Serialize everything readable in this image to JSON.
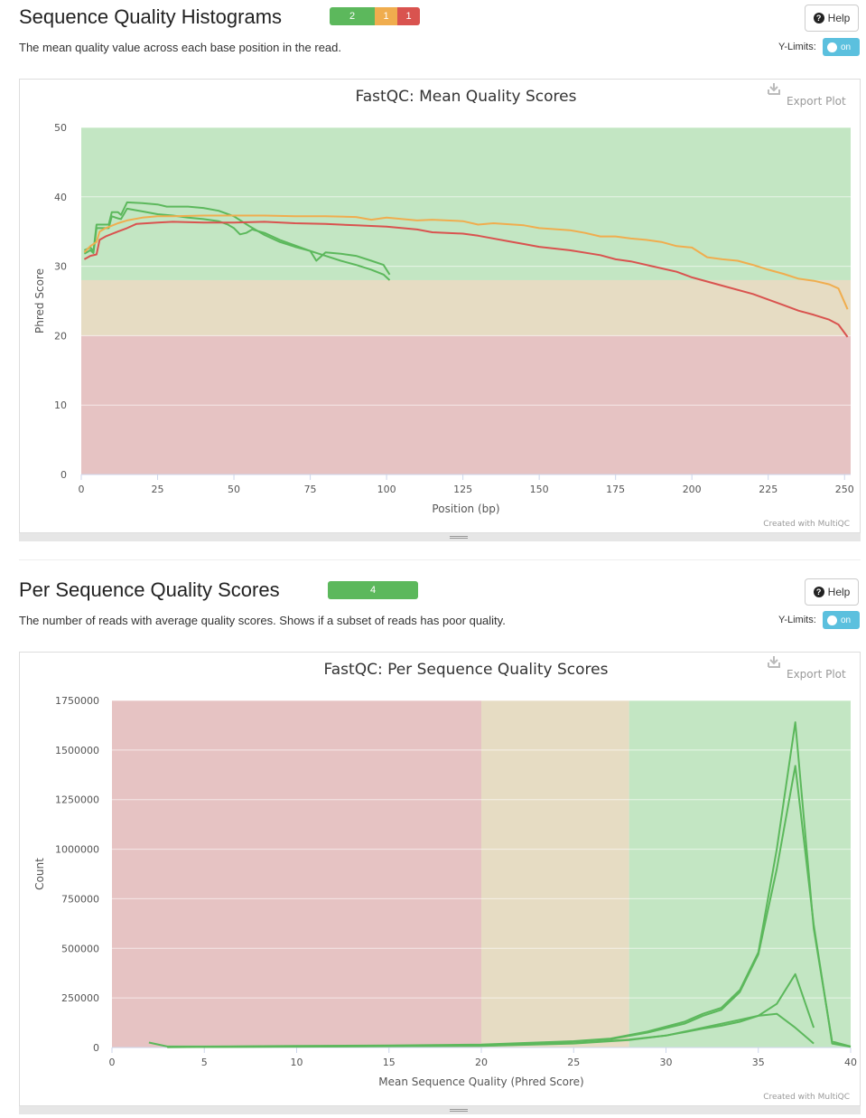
{
  "sections": [
    {
      "title": "Sequence Quality Histograms",
      "status": [
        {
          "label": "2",
          "color": "#5cb85c",
          "width": 50
        },
        {
          "label": "1",
          "color": "#f0ad4e",
          "width": 25
        },
        {
          "label": "1",
          "color": "#d9534f",
          "width": 25
        }
      ],
      "description": "The mean quality value across each base position in the read.",
      "help_label": "Help",
      "ylimits_label": "Y-Limits:",
      "toggle_label": "on"
    },
    {
      "title": "Per Sequence Quality Scores",
      "status": [
        {
          "label": "4",
          "color": "#5cb85c",
          "width": 100
        }
      ],
      "description": "The number of reads with average quality scores. Shows if a subset of reads has poor quality.",
      "help_label": "Help",
      "ylimits_label": "Y-Limits:",
      "toggle_label": "on"
    }
  ],
  "export_label": "Export Plot",
  "credit": "Created with MultiQC",
  "chart_data": [
    {
      "type": "line",
      "title": "FastQC: Mean Quality Scores",
      "xlabel": "Position (bp)",
      "ylabel": "Phred Score",
      "xlim": [
        0,
        252
      ],
      "ylim": [
        0,
        50
      ],
      "x_ticks": [
        0,
        25,
        50,
        75,
        100,
        125,
        150,
        175,
        200,
        225,
        250
      ],
      "y_ticks": [
        0,
        10,
        20,
        30,
        40,
        50
      ],
      "bands": [
        {
          "from": 28,
          "to": 50,
          "color": "#c3e6c3"
        },
        {
          "from": 20,
          "to": 28,
          "color": "#e6dcc3"
        },
        {
          "from": 0,
          "to": 20,
          "color": "#e6c3c3"
        }
      ],
      "series": [
        {
          "color": "#5cb85c",
          "points": [
            [
              1,
              32.3
            ],
            [
              3,
              32.7
            ],
            [
              4,
              32.2
            ],
            [
              5,
              36
            ],
            [
              7,
              36
            ],
            [
              9,
              36
            ],
            [
              10,
              37.8
            ],
            [
              12,
              37.8
            ],
            [
              13,
              37.4
            ],
            [
              15,
              39.2
            ],
            [
              20,
              39.1
            ],
            [
              25,
              38.9
            ],
            [
              28,
              38.6
            ],
            [
              30,
              38.6
            ],
            [
              35,
              38.6
            ],
            [
              40,
              38.4
            ],
            [
              45,
              38
            ],
            [
              50,
              37.2
            ],
            [
              55,
              35.8
            ],
            [
              60,
              34.5
            ],
            [
              65,
              33.5
            ],
            [
              70,
              32.8
            ],
            [
              75,
              32.2
            ],
            [
              77,
              30.8
            ],
            [
              80,
              32
            ],
            [
              85,
              31.8
            ],
            [
              90,
              31.5
            ],
            [
              95,
              30.8
            ],
            [
              99,
              30.2
            ],
            [
              101,
              28.8
            ]
          ]
        },
        {
          "color": "#5cb85c",
          "points": [
            [
              1,
              31.8
            ],
            [
              3,
              32.3
            ],
            [
              4,
              31.9
            ],
            [
              5,
              35.5
            ],
            [
              7,
              35.5
            ],
            [
              9,
              35.5
            ],
            [
              10,
              37.2
            ],
            [
              12,
              36.9
            ],
            [
              13,
              36.8
            ],
            [
              15,
              38.3
            ],
            [
              20,
              37.9
            ],
            [
              25,
              37.5
            ],
            [
              30,
              37.3
            ],
            [
              35,
              37
            ],
            [
              40,
              36.8
            ],
            [
              45,
              36.5
            ],
            [
              48,
              36
            ],
            [
              50,
              35.5
            ],
            [
              52,
              34.6
            ],
            [
              54,
              34.8
            ],
            [
              56,
              35.3
            ],
            [
              60,
              34.8
            ],
            [
              65,
              33.8
            ],
            [
              70,
              33
            ],
            [
              75,
              32.2
            ],
            [
              80,
              31.5
            ],
            [
              85,
              30.8
            ],
            [
              90,
              30.2
            ],
            [
              95,
              29.5
            ],
            [
              99,
              28.8
            ],
            [
              101,
              28
            ]
          ]
        },
        {
          "color": "#f0ad4e",
          "points": [
            [
              1,
              32
            ],
            [
              3,
              32.9
            ],
            [
              5,
              33.5
            ],
            [
              6,
              35
            ],
            [
              8,
              35.5
            ],
            [
              12,
              36.2
            ],
            [
              15,
              36.6
            ],
            [
              20,
              37
            ],
            [
              25,
              37.2
            ],
            [
              30,
              37.2
            ],
            [
              40,
              37.3
            ],
            [
              50,
              37.3
            ],
            [
              60,
              37.3
            ],
            [
              70,
              37.2
            ],
            [
              80,
              37.2
            ],
            [
              90,
              37.1
            ],
            [
              95,
              36.7
            ],
            [
              100,
              37
            ],
            [
              110,
              36.6
            ],
            [
              115,
              36.7
            ],
            [
              125,
              36.5
            ],
            [
              130,
              36
            ],
            [
              135,
              36.2
            ],
            [
              145,
              35.9
            ],
            [
              150,
              35.5
            ],
            [
              160,
              35.2
            ],
            [
              165,
              34.8
            ],
            [
              170,
              34.3
            ],
            [
              175,
              34.3
            ],
            [
              180,
              34
            ],
            [
              185,
              33.8
            ],
            [
              190,
              33.5
            ],
            [
              195,
              32.9
            ],
            [
              200,
              32.7
            ],
            [
              205,
              31.3
            ],
            [
              210,
              31
            ],
            [
              215,
              30.8
            ],
            [
              220,
              30.2
            ],
            [
              225,
              29.5
            ],
            [
              230,
              28.9
            ],
            [
              235,
              28.2
            ],
            [
              240,
              27.9
            ],
            [
              245,
              27.4
            ],
            [
              248,
              26.8
            ],
            [
              251,
              23.8
            ]
          ]
        },
        {
          "color": "#d9534f",
          "points": [
            [
              1,
              31
            ],
            [
              3,
              31.5
            ],
            [
              5,
              31.7
            ],
            [
              6,
              33.8
            ],
            [
              8,
              34.3
            ],
            [
              12,
              35
            ],
            [
              15,
              35.5
            ],
            [
              18,
              36.1
            ],
            [
              25,
              36.3
            ],
            [
              30,
              36.4
            ],
            [
              40,
              36.3
            ],
            [
              50,
              36.3
            ],
            [
              60,
              36.4
            ],
            [
              70,
              36.2
            ],
            [
              80,
              36.1
            ],
            [
              90,
              35.9
            ],
            [
              100,
              35.7
            ],
            [
              110,
              35.3
            ],
            [
              115,
              34.9
            ],
            [
              125,
              34.7
            ],
            [
              130,
              34.4
            ],
            [
              140,
              33.6
            ],
            [
              145,
              33.2
            ],
            [
              150,
              32.8
            ],
            [
              160,
              32.3
            ],
            [
              170,
              31.6
            ],
            [
              175,
              31
            ],
            [
              180,
              30.7
            ],
            [
              190,
              29.7
            ],
            [
              195,
              29.2
            ],
            [
              200,
              28.4
            ],
            [
              210,
              27.2
            ],
            [
              220,
              26
            ],
            [
              230,
              24.4
            ],
            [
              235,
              23.6
            ],
            [
              240,
              23
            ],
            [
              245,
              22.3
            ],
            [
              248,
              21.6
            ],
            [
              251,
              19.8
            ]
          ]
        }
      ]
    },
    {
      "type": "line",
      "title": "FastQC: Per Sequence Quality Scores",
      "xlabel": "Mean Sequence Quality (Phred Score)",
      "ylabel": "Count",
      "xlim": [
        0,
        40
      ],
      "ylim": [
        0,
        1750000
      ],
      "x_ticks": [
        0,
        5,
        10,
        15,
        20,
        25,
        30,
        35,
        40
      ],
      "y_ticks": [
        0,
        250000,
        500000,
        750000,
        1000000,
        1250000,
        1500000,
        1750000
      ],
      "bands": [
        {
          "from": 28,
          "to": 40,
          "color": "#c3e6c3"
        },
        {
          "from": 20,
          "to": 28,
          "color": "#e6dcc3"
        },
        {
          "from": 0,
          "to": 20,
          "color": "#e6c3c3"
        }
      ],
      "series": [
        {
          "color": "#5cb85c",
          "points": [
            [
              2,
              25000
            ],
            [
              3,
              5000
            ],
            [
              5,
              5000
            ],
            [
              10,
              8000
            ],
            [
              15,
              10000
            ],
            [
              20,
              15000
            ],
            [
              22,
              22000
            ],
            [
              25,
              32000
            ],
            [
              27,
              45000
            ],
            [
              29,
              80000
            ],
            [
              31,
              130000
            ],
            [
              32,
              170000
            ],
            [
              33,
              200000
            ],
            [
              34,
              290000
            ],
            [
              35,
              480000
            ],
            [
              36,
              1000000
            ],
            [
              37,
              1640000
            ],
            [
              38,
              600000
            ],
            [
              39,
              30000
            ],
            [
              40,
              5000
            ]
          ]
        },
        {
          "color": "#5cb85c",
          "points": [
            [
              3,
              3000
            ],
            [
              5,
              4000
            ],
            [
              10,
              6000
            ],
            [
              15,
              8000
            ],
            [
              20,
              12000
            ],
            [
              22,
              18000
            ],
            [
              25,
              30000
            ],
            [
              27,
              42000
            ],
            [
              29,
              75000
            ],
            [
              31,
              120000
            ],
            [
              32,
              160000
            ],
            [
              33,
              190000
            ],
            [
              34,
              280000
            ],
            [
              35,
              470000
            ],
            [
              36,
              900000
            ],
            [
              37,
              1420000
            ],
            [
              38,
              620000
            ],
            [
              39,
              20000
            ],
            [
              40,
              3000
            ]
          ]
        },
        {
          "color": "#5cb85c",
          "points": [
            [
              3,
              2000
            ],
            [
              10,
              5000
            ],
            [
              20,
              9000
            ],
            [
              25,
              22000
            ],
            [
              28,
              40000
            ],
            [
              30,
              60000
            ],
            [
              32,
              95000
            ],
            [
              33,
              110000
            ],
            [
              34,
              130000
            ],
            [
              35,
              160000
            ],
            [
              36,
              220000
            ],
            [
              37,
              370000
            ],
            [
              38,
              100000
            ]
          ]
        },
        {
          "color": "#5cb85c",
          "points": [
            [
              3,
              2000
            ],
            [
              10,
              4000
            ],
            [
              20,
              8000
            ],
            [
              25,
              20000
            ],
            [
              28,
              38000
            ],
            [
              30,
              60000
            ],
            [
              32,
              100000
            ],
            [
              34,
              140000
            ],
            [
              35,
              160000
            ],
            [
              36,
              170000
            ],
            [
              37,
              100000
            ],
            [
              38,
              20000
            ]
          ]
        }
      ]
    }
  ]
}
